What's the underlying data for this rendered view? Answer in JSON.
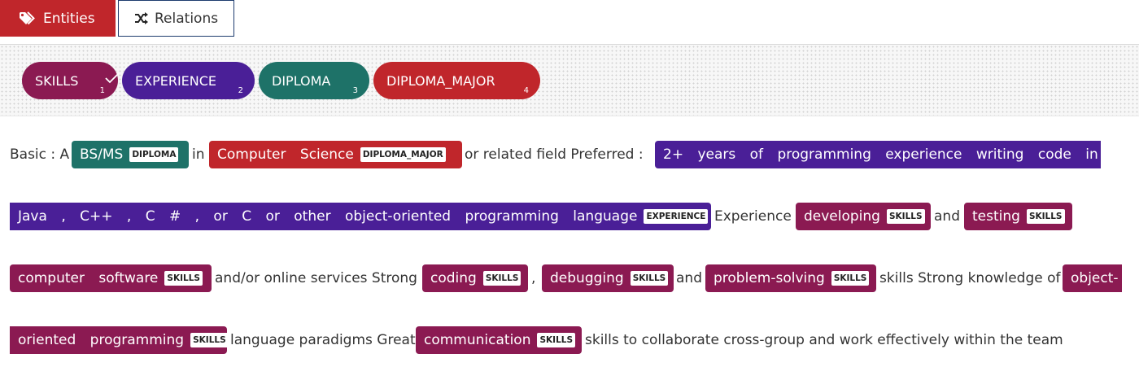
{
  "tabs": {
    "entities": "Entities",
    "relations": "Relations"
  },
  "labels": [
    {
      "name": "SKILLS",
      "shortcut": "1",
      "color": "#8b1a52",
      "selected": true
    },
    {
      "name": "EXPERIENCE",
      "shortcut": "2",
      "color": "#4a1f97",
      "selected": false
    },
    {
      "name": "DIPLOMA",
      "shortcut": "3",
      "color": "#1e7268",
      "selected": false
    },
    {
      "name": "DIPLOMA_MAJOR",
      "shortcut": "4",
      "color": "#c0262b",
      "selected": false
    }
  ],
  "doc": {
    "t1": "Basic : A",
    "e1": {
      "text": "BS/MS",
      "label": "DIPLOMA"
    },
    "t2": "in",
    "e2": {
      "text": "Computer Science",
      "label": "DIPLOMA_MAJOR"
    },
    "t3": "or related field Preferred :",
    "e3a": {
      "text": "2+ years of programming experience writing code in"
    },
    "e3b": {
      "text": "Java , C++ , C # , or C or other object-oriented programming language",
      "label": "EXPERIENCE"
    },
    "t4": "Experience",
    "e4": {
      "text": "developing",
      "label": "SKILLS"
    },
    "t5": "and",
    "e5": {
      "text": "testing",
      "label": "SKILLS"
    },
    "e6": {
      "text": "computer software",
      "label": "SKILLS"
    },
    "t6": "and/or online services Strong",
    "e7": {
      "text": "coding",
      "label": "SKILLS"
    },
    "t7": ",",
    "e8": {
      "text": "debugging",
      "label": "SKILLS"
    },
    "t8": "and",
    "e9": {
      "text": "problem-solving",
      "label": "SKILLS"
    },
    "t9": "skills Strong knowledge of",
    "e10a": {
      "text": "object-"
    },
    "e10b": {
      "text": "oriented programming",
      "label": "SKILLS"
    },
    "t10": "language paradigms Great",
    "e11": {
      "text": "communication",
      "label": "SKILLS"
    },
    "t11": "skills to collaborate cross-group and work effectively within the team"
  },
  "icons": {
    "entities": "tags-icon",
    "relations": "shuffle-icon",
    "selected": "check-icon"
  }
}
